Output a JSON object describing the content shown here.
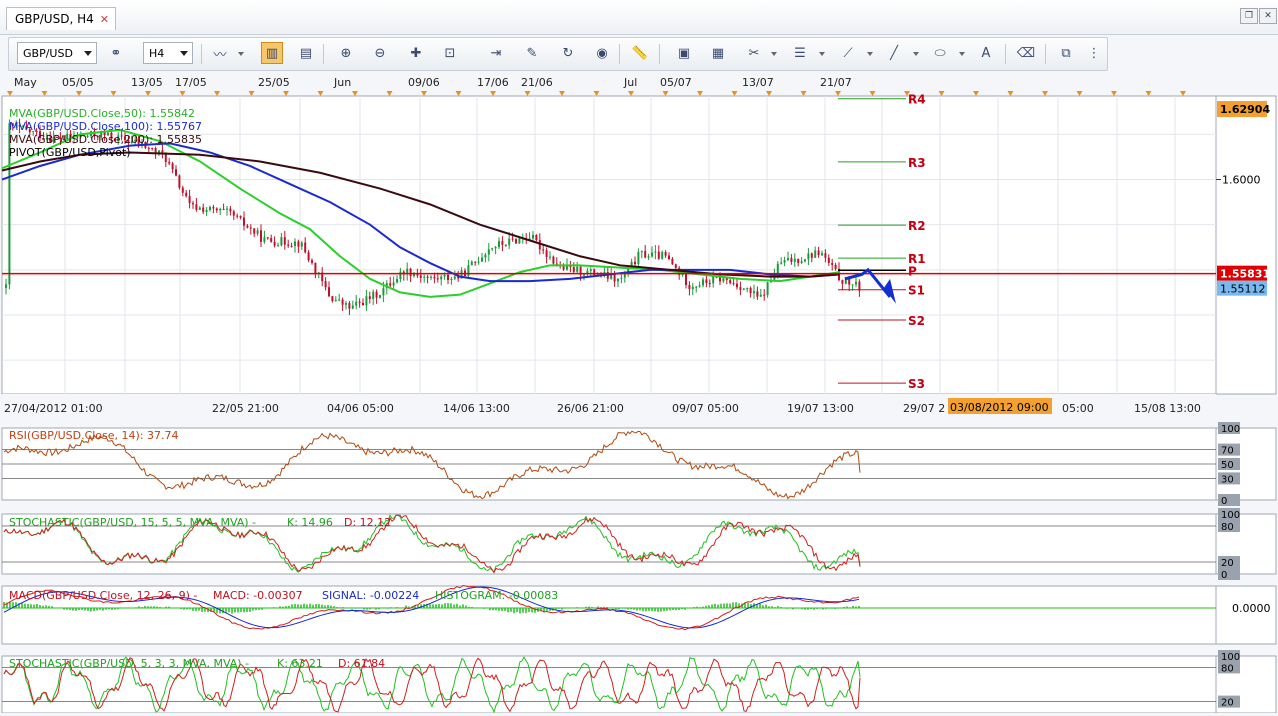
{
  "tab": {
    "title": "GBP/USD, H4",
    "close": "✕"
  },
  "window_controls": {
    "restore": "❐",
    "close": "✕"
  },
  "toolbar": {
    "symbol": "GBP/USD",
    "timeframe": "H4"
  },
  "colors": {
    "bull": "#1a9a3a",
    "bear": "#c0102a",
    "mva50": "#28d028",
    "mva100": "#1a2ad0",
    "mva200": "#3a0a10",
    "pivot": "#e00000",
    "rsi": "#b04a10",
    "arrow": "#1030d0"
  },
  "top_axis": {
    "labels": [
      "May",
      "05/05",
      "13/05",
      "17/05",
      "25/05",
      "Jun",
      "09/06",
      "17/06",
      "21/06",
      "Jul",
      "05/07",
      "13/07",
      "21/07"
    ]
  },
  "main_chart": {
    "legend": [
      {
        "label": "MVA(GBP/USD.Close,50): 1.55842",
        "color": "#28b028"
      },
      {
        "label": "MVA(GBP/USD.Close,100): 1.55767",
        "color": "#1a2ad0"
      },
      {
        "label": "MVA(GBP/USD.Close,200): 1.55835",
        "color": "#3a0a10"
      },
      {
        "label": "PIVOT(GBP/USD,Pivot)",
        "color": "#000000"
      }
    ],
    "price_axis": {
      "ticks": [
        "1.6000"
      ],
      "top_label": "1.62904",
      "pivot_label": "1.55831",
      "current_label": "1.55112"
    },
    "pivot_levels": [
      {
        "name": "R4",
        "value": 1.6358
      },
      {
        "name": "R3",
        "value": 1.6078
      },
      {
        "name": "R2",
        "value": 1.5798
      },
      {
        "name": "R1",
        "value": 1.5652
      },
      {
        "name": "P",
        "value": 1.5598
      },
      {
        "name": "S1",
        "value": 1.5512
      },
      {
        "name": "S2",
        "value": 1.5378
      },
      {
        "name": "S3",
        "value": 1.5098
      }
    ],
    "date_axis": {
      "labels": [
        "27/04/2012 01:00",
        "22/05 21:00",
        "04/06 05:00",
        "14/06 13:00",
        "26/06 21:00",
        "09/07 05:00",
        "19/07 13:00",
        "29/07 2",
        "05:00",
        "15/08 13:00"
      ],
      "highlight": "03/08/2012 09:00"
    }
  },
  "indicators": {
    "rsi": {
      "label": "RSI(GBP/USD.Close, 14): 37.74",
      "levels": [
        "100",
        "70",
        "50",
        "30",
        "0"
      ]
    },
    "stoch1": {
      "label_name": "STOCHASTIC(GBP/USD, 15, 5, 5, MVA, MVA) -",
      "label_k": "K: 14.96",
      "label_d": "D: 12.12",
      "levels": [
        "100",
        "80",
        "20",
        "0"
      ]
    },
    "macd": {
      "label_name": "MACD(GBP/USD.Close, 12, 26, 9) -",
      "label_macd": "MACD: -0.00307",
      "label_signal": "SIGNAL: -0.00224",
      "label_hist": "HISTOGRAM: -0.00083",
      "levels": [
        "0.0000"
      ]
    },
    "stoch2": {
      "label_name": "STOCHASTIC(GBP/USD, 5, 3, 3, MVA, MVA) -",
      "label_k": "K: 63.21",
      "label_d": "D: 61.84",
      "levels": [
        "100",
        "80",
        "20"
      ]
    }
  }
}
